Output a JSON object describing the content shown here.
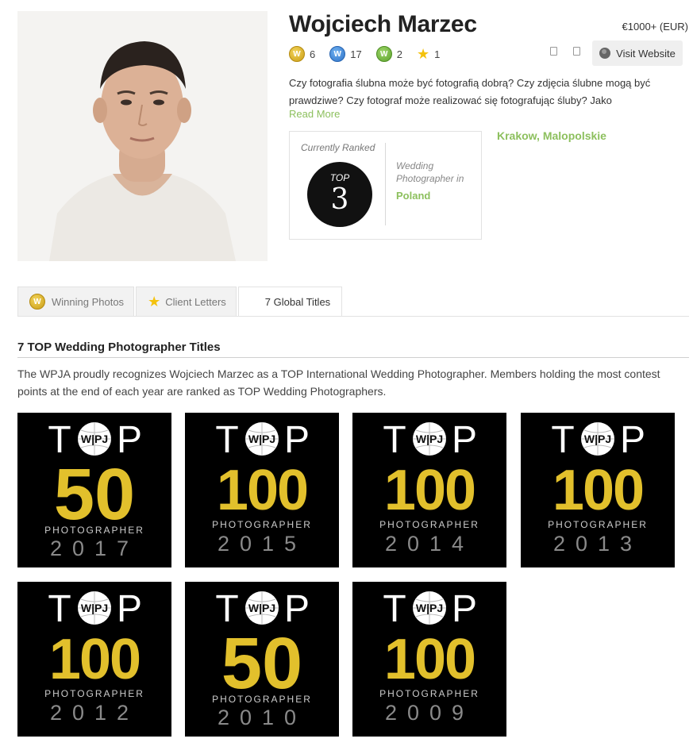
{
  "profile": {
    "name": "Wojciech Marzec",
    "price": "€1000+ (EUR)",
    "badges": [
      {
        "icon": "gold-w-badge-icon",
        "letter": "W",
        "count": "6"
      },
      {
        "icon": "blue-w-badge-icon",
        "letter": "W",
        "count": "17"
      },
      {
        "icon": "green-w-badge-icon",
        "letter": "W",
        "count": "2"
      },
      {
        "icon": "star-icon",
        "letter": "",
        "count": "1"
      }
    ],
    "visit_website": "Visit Website",
    "bio": "Czy fotografia ślubna może być fotografią dobrą? Czy zdjęcia ślubne mogą być prawdziwe? Czy fotograf może realizować się fotografując śluby? Jako",
    "read_more": "Read More",
    "location": "Krakow, Malopolskie"
  },
  "rank": {
    "label": "Currently Ranked",
    "top_word": "TOP",
    "number": "3",
    "category": "Wedding Photographer in",
    "country": "Poland"
  },
  "tabs": [
    {
      "label": "Winning Photos",
      "icon": "gold-w-badge-icon"
    },
    {
      "label": "Client Letters",
      "icon": "star-icon"
    },
    {
      "label": "7 Global Titles",
      "icon": ""
    }
  ],
  "titles_section": {
    "heading": "7 TOP Wedding Photographer Titles",
    "description": "The WPJA proudly recognizes Wojciech Marzec as a TOP International Wedding Photographer. Members holding the most contest points at the end of each year are ranked as TOP Wedding Photographers."
  },
  "awards": [
    {
      "top_word": "T P",
      "logo": "W|PJ",
      "rank": "50",
      "label": "PHOTOGRAPHER",
      "year": "2017"
    },
    {
      "top_word": "T P",
      "logo": "W|PJ",
      "rank": "100",
      "label": "PHOTOGRAPHER",
      "year": "2015"
    },
    {
      "top_word": "T P",
      "logo": "W|PJ",
      "rank": "100",
      "label": "PHOTOGRAPHER",
      "year": "2014"
    },
    {
      "top_word": "T P",
      "logo": "W|PJ",
      "rank": "100",
      "label": "PHOTOGRAPHER",
      "year": "2013"
    },
    {
      "top_word": "T P",
      "logo": "W|PJ",
      "rank": "100",
      "label": "PHOTOGRAPHER",
      "year": "2012"
    },
    {
      "top_word": "T P",
      "logo": "W|PJ",
      "rank": "50",
      "label": "PHOTOGRAPHER",
      "year": "2010"
    },
    {
      "top_word": "T P",
      "logo": "W|PJ",
      "rank": "100",
      "label": "PHOTOGRAPHER",
      "year": "2009"
    }
  ],
  "colors": {
    "accent_green": "#8dc05e",
    "award_gold": "#e2c02c",
    "award_year_gray": "#8a8a8a"
  }
}
